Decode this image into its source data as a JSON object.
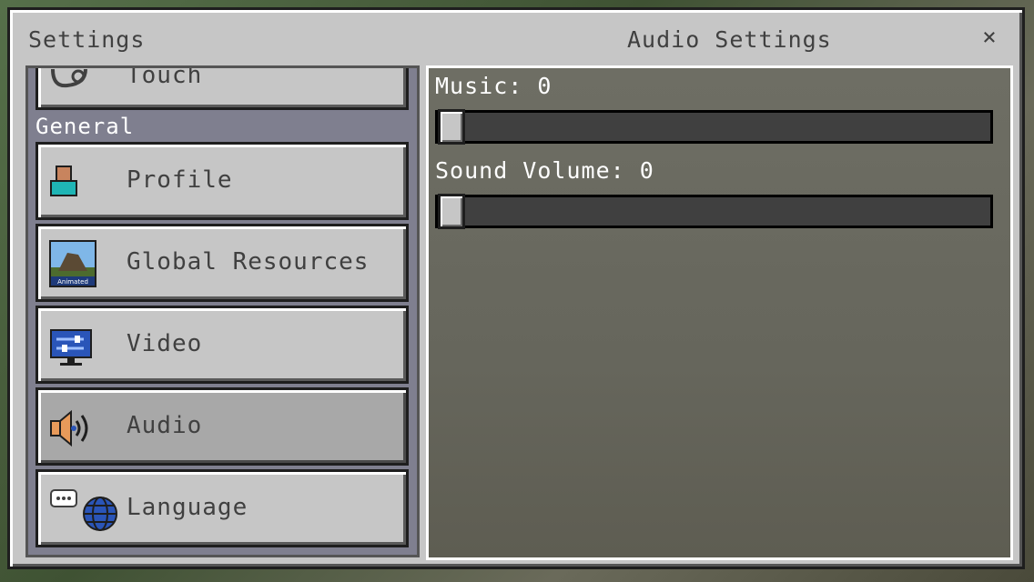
{
  "window": {
    "title_left": "Settings",
    "title_right": "Audio Settings",
    "close_label": "×"
  },
  "sidebar": {
    "partial_item": {
      "label": "Touch",
      "icon": "touch-icon"
    },
    "section_label": "General",
    "items": [
      {
        "label": "Profile",
        "icon": "profile-icon",
        "selected": false
      },
      {
        "label": "Global Resources",
        "icon": "global-resources-icon",
        "icon_caption": "Animated",
        "selected": false
      },
      {
        "label": "Video",
        "icon": "video-icon",
        "selected": false
      },
      {
        "label": "Audio",
        "icon": "audio-icon",
        "selected": true
      },
      {
        "label": "Language",
        "icon": "language-icon",
        "selected": false
      }
    ]
  },
  "audio": {
    "music": {
      "label": "Music: 0",
      "value": 0
    },
    "sound_volume": {
      "label": "Sound Volume: 0",
      "value": 0
    }
  },
  "colors": {
    "panel": "#c6c6c6",
    "text_dark": "#404040",
    "text_light": "#ffffff",
    "slider_track": "#404040"
  }
}
